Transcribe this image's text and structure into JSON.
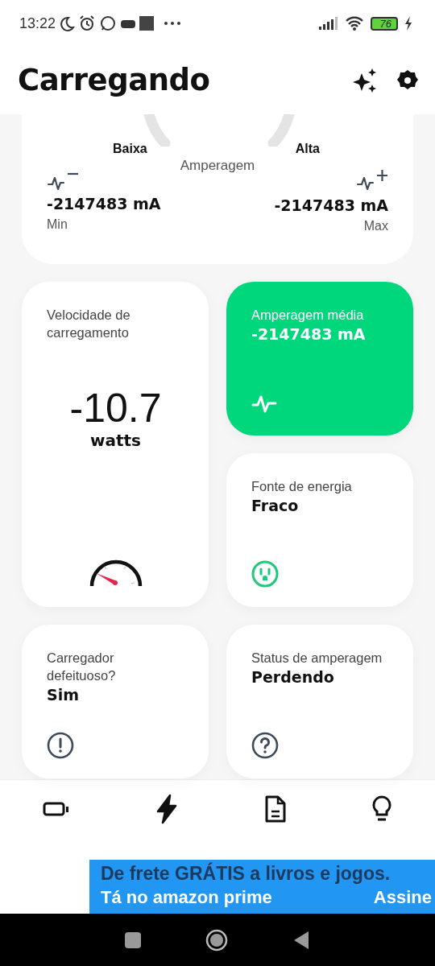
{
  "status_bar": {
    "time": "13:22",
    "battery": "76"
  },
  "header": {
    "title": "Carregando"
  },
  "amperage_card": {
    "low_label": "Baixa",
    "high_label": "Alta",
    "title": "Amperagem",
    "min": {
      "value": "-2147483 mA",
      "label": "Min"
    },
    "max": {
      "value": "-2147483 mA",
      "label": "Max"
    }
  },
  "speed_card": {
    "label": "Velocidade de carregamento",
    "value": "-10.7",
    "unit": "watts"
  },
  "tiles": [
    {
      "kind": "pulse",
      "label": "Amperagem média",
      "value": "-2147483 mA",
      "highlighted": true
    },
    {
      "kind": "plug",
      "label": "Fonte de energia",
      "value": "Fraco",
      "highlighted": false
    },
    {
      "kind": "alert",
      "label": "Carregador defeituoso?",
      "value": "Sim",
      "highlighted": false
    },
    {
      "kind": "question",
      "label": "Status de amperagem",
      "value": "Perdendo",
      "highlighted": false
    }
  ],
  "bottom_nav": [
    {
      "kind": "battery",
      "selected": false
    },
    {
      "kind": "bolt",
      "selected": true
    },
    {
      "kind": "document",
      "selected": false
    },
    {
      "kind": "bulb",
      "selected": false
    }
  ],
  "ad": {
    "headline": "De frete GRÁTIS a livros e jogos.",
    "tagline": "Tá no amazon prime",
    "cta": "Assine"
  }
}
